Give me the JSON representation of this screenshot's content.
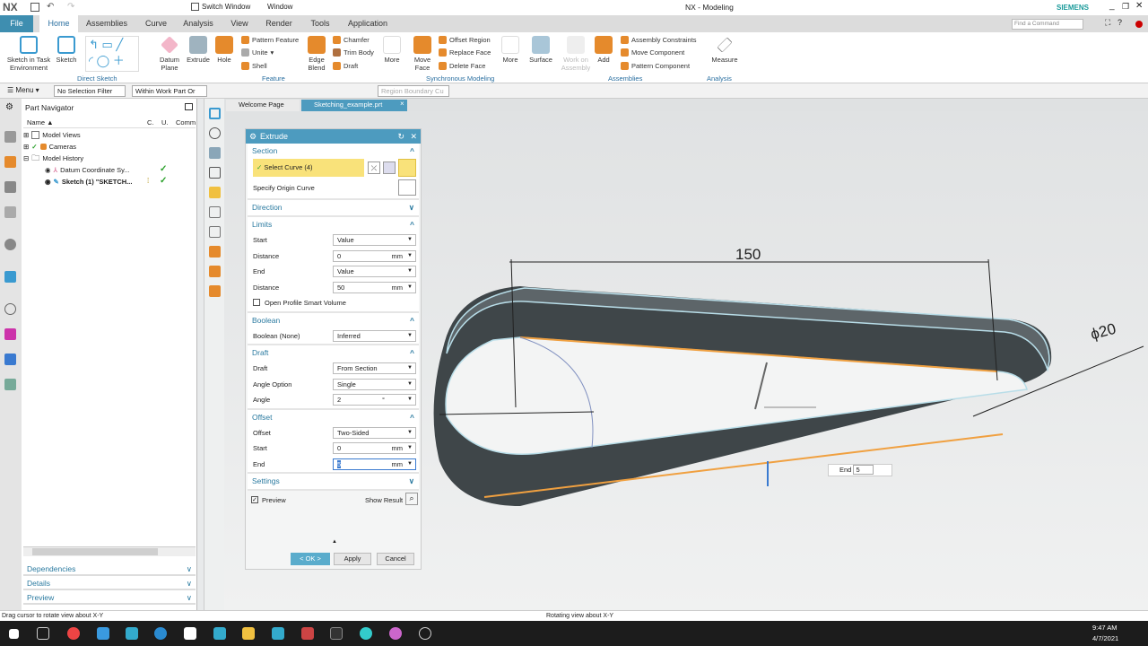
{
  "app": {
    "logo": "NX",
    "title": "NX - Modeling",
    "brand": "SIEMENS",
    "switch_window": "Switch Window",
    "window": "Window",
    "find_placeholder": "Find a Command"
  },
  "tabs": [
    "File",
    "Home",
    "Assemblies",
    "Curve",
    "Analysis",
    "View",
    "Render",
    "Tools",
    "Application"
  ],
  "ribbon": {
    "sketch_task": "Sketch in Task Environment",
    "sketch": "Sketch",
    "direct_sketch": "Direct Sketch",
    "datum_plane": "Datum Plane",
    "extrude": "Extrude",
    "hole": "Hole",
    "pattern_feature": "Pattern Feature",
    "unite": "Unite",
    "shell": "Shell",
    "edge_blend": "Edge Blend",
    "chamfer": "Chamfer",
    "trim_body": "Trim Body",
    "draft": "Draft",
    "more": "More",
    "feature": "Feature",
    "move_face": "Move Face",
    "offset_region": "Offset Region",
    "replace_face": "Replace Face",
    "delete_face": "Delete Face",
    "sync_modeling": "Synchronous Modeling",
    "surface": "Surface",
    "work_on_assembly": "Work on Assembly",
    "add": "Add",
    "assembly_constraints": "Assembly Constraints",
    "move_component": "Move Component",
    "pattern_component": "Pattern Component",
    "assemblies": "Assemblies",
    "measure": "Measure",
    "analysis": "Analysis"
  },
  "selection_bar": {
    "menu": "Menu",
    "filter": "No Selection Filter",
    "scope": "Within Work Part Or",
    "curve_rule": "Region Boundary Cu"
  },
  "navigator": {
    "title": "Part Navigator",
    "columns": [
      "Name",
      "C.",
      "U.",
      "Comm"
    ],
    "items": [
      {
        "label": "Model Views"
      },
      {
        "label": "Cameras"
      },
      {
        "label": "Model History"
      },
      {
        "label": "Datum Coordinate Sy..."
      },
      {
        "label": "Sketch (1) \"SKETCH..."
      }
    ],
    "panes": [
      "Dependencies",
      "Details",
      "Preview"
    ]
  },
  "doc_tabs": [
    "Welcome Page",
    "Sketching_example.prt"
  ],
  "dialog": {
    "title": "Extrude",
    "section": {
      "header": "Section",
      "select_curve": "Select Curve (4)",
      "origin_curve": "Specify Origin Curve"
    },
    "direction": "Direction",
    "limits": {
      "header": "Limits",
      "start_label": "Start",
      "start": "Value",
      "dist1_label": "Distance",
      "dist1": "0",
      "end_label": "End",
      "end": "Value",
      "dist2_label": "Distance",
      "dist2": "50",
      "unit": "mm",
      "open_profile": "Open Profile Smart Volume"
    },
    "boolean": {
      "header": "Boolean",
      "label": "Boolean (None)",
      "value": "Inferred"
    },
    "draft": {
      "header": "Draft",
      "draft_label": "Draft",
      "draft": "From Section",
      "angle_opt_label": "Angle Option",
      "angle_opt": "Single",
      "angle_label": "Angle",
      "angle": "2",
      "deg": "°"
    },
    "offset": {
      "header": "Offset",
      "offset_label": "Offset",
      "offset": "Two-Sided",
      "start_label": "Start",
      "start": "0",
      "end_label": "End",
      "end": "5",
      "unit": "mm"
    },
    "settings": "Settings",
    "preview": "Preview",
    "show_result": "Show Result",
    "ok": "< OK >",
    "apply": "Apply",
    "cancel": "Cancel"
  },
  "viewport": {
    "dim_length": "150",
    "dim_diameter": "ϕ20",
    "end_label": "End",
    "end_value": "5"
  },
  "status": {
    "left": "Drag cursor to rotate view about X-Y",
    "center": "Rotating view about X-Y"
  },
  "taskbar": {
    "time": "9:47 AM",
    "date": "4/7/2021"
  },
  "colors": {
    "accent": "#4d9bbf",
    "file_tab": "#3e8eb0",
    "highlight": "#f9e27a",
    "body": "#4a5256",
    "edge": "#f0a040"
  }
}
